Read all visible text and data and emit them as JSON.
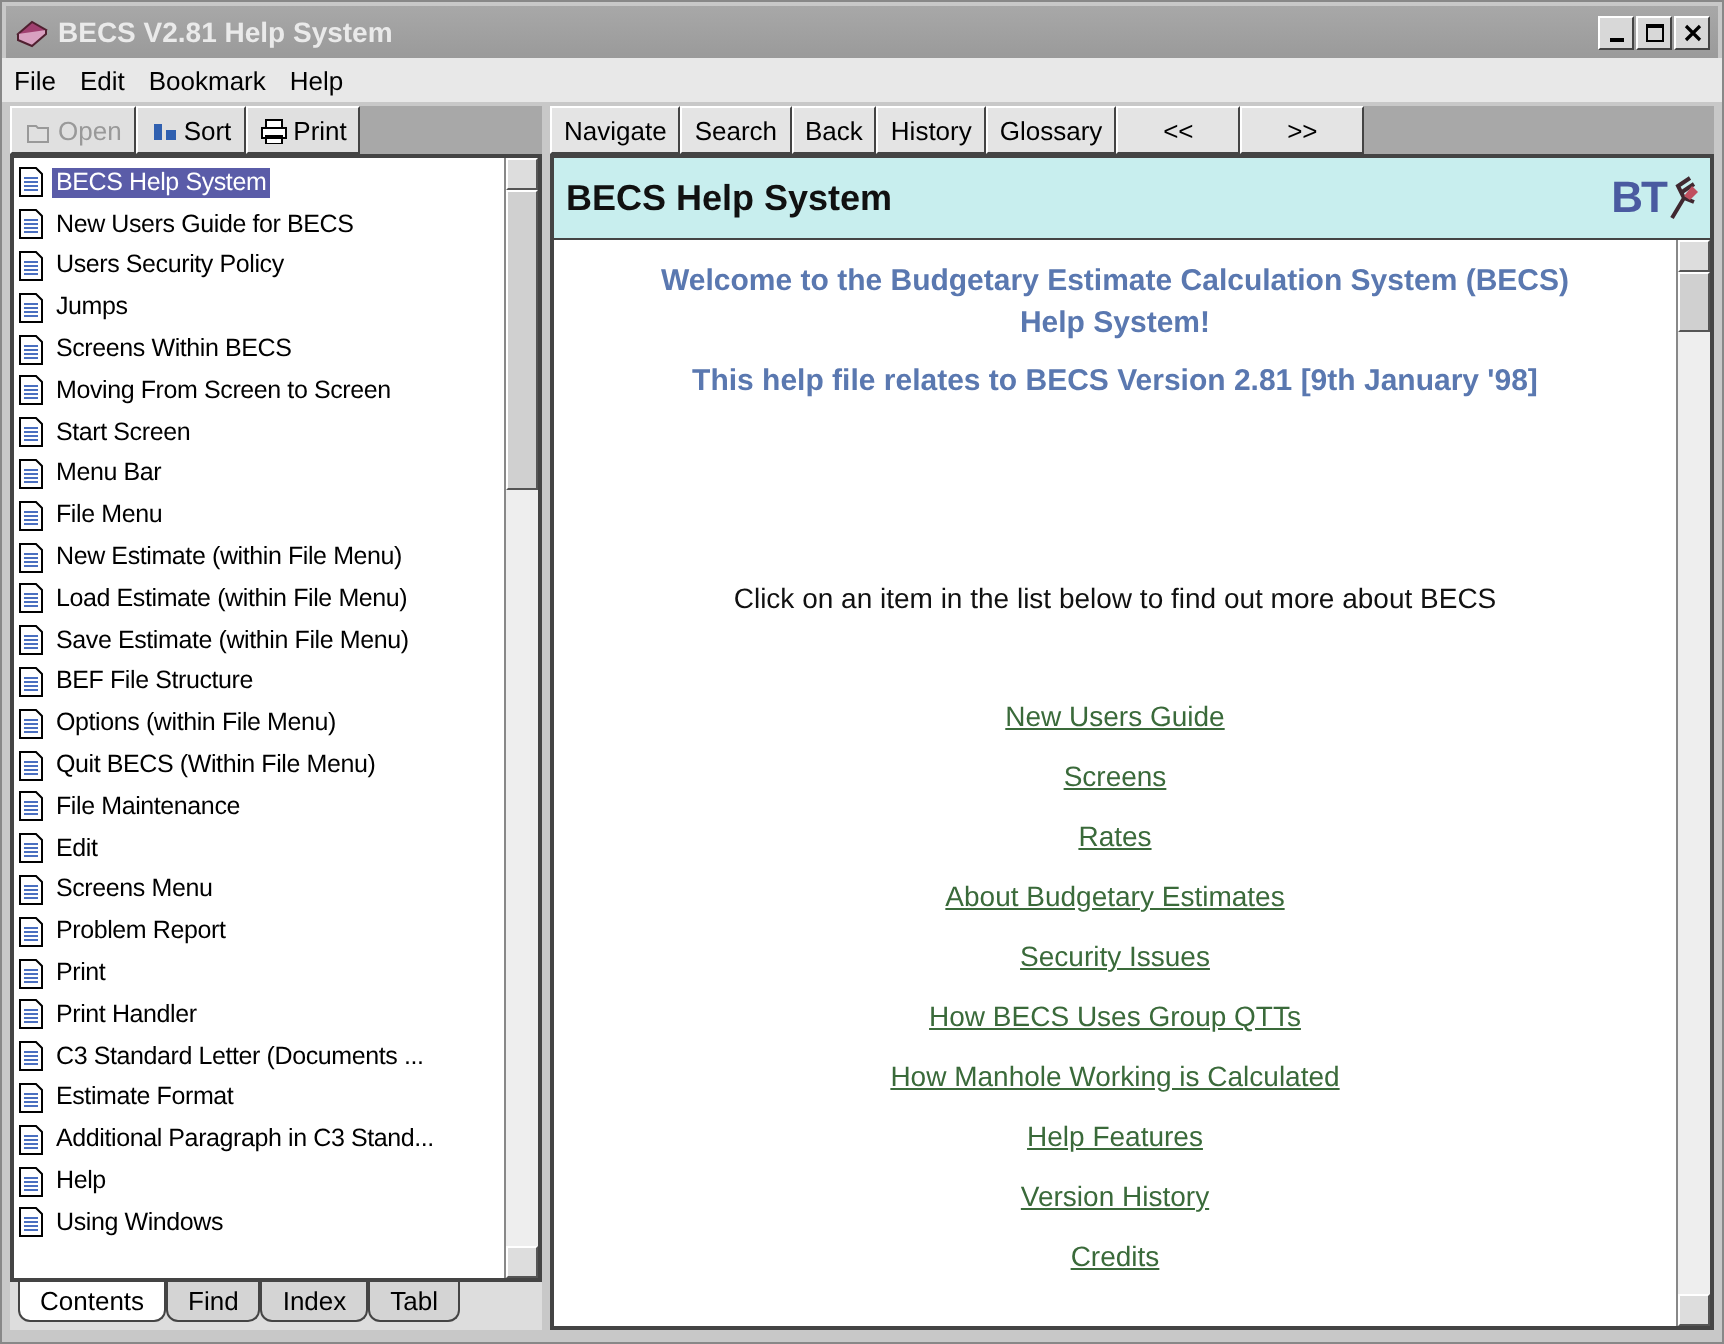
{
  "window": {
    "title": "BECS V2.81 Help System"
  },
  "menu": [
    "File",
    "Edit",
    "Bookmark",
    "Help"
  ],
  "toolbar": [
    {
      "label": "Open",
      "disabled": true,
      "kind": "open"
    },
    {
      "label": "Sort",
      "disabled": false,
      "kind": "sort"
    },
    {
      "label": "Print",
      "disabled": false,
      "kind": "print"
    }
  ],
  "topics": [
    {
      "label": "BECS Help System",
      "selected": true
    },
    {
      "label": "New Users Guide for BECS",
      "selected": false
    },
    {
      "label": "Users Security Policy",
      "selected": false
    },
    {
      "label": "Jumps",
      "selected": false
    },
    {
      "label": "Screens Within BECS",
      "selected": false
    },
    {
      "label": "Moving From Screen to Screen",
      "selected": false
    },
    {
      "label": "Start Screen",
      "selected": false
    },
    {
      "label": "Menu Bar",
      "selected": false
    },
    {
      "label": "File Menu",
      "selected": false
    },
    {
      "label": "New Estimate (within File Menu)",
      "selected": false
    },
    {
      "label": "Load Estimate (within File Menu)",
      "selected": false
    },
    {
      "label": "Save Estimate (within File Menu)",
      "selected": false
    },
    {
      "label": "BEF File Structure",
      "selected": false
    },
    {
      "label": "Options (within File Menu)",
      "selected": false
    },
    {
      "label": "Quit BECS (Within File Menu)",
      "selected": false
    },
    {
      "label": "File Maintenance",
      "selected": false
    },
    {
      "label": "Edit",
      "selected": false
    },
    {
      "label": "Screens Menu",
      "selected": false
    },
    {
      "label": "Problem Report",
      "selected": false
    },
    {
      "label": "Print",
      "selected": false
    },
    {
      "label": "Print Handler",
      "selected": false
    },
    {
      "label": "C3 Standard Letter (Documents ...",
      "selected": false
    },
    {
      "label": "Estimate Format",
      "selected": false
    },
    {
      "label": "Additional Paragraph in C3 Stand...",
      "selected": false
    },
    {
      "label": "Help",
      "selected": false
    },
    {
      "label": "Using Windows",
      "selected": false
    }
  ],
  "tabs": [
    {
      "label": "Contents",
      "selected": true
    },
    {
      "label": "Find",
      "selected": false
    },
    {
      "label": "Index",
      "selected": false
    },
    {
      "label": "Tabl",
      "selected": false
    }
  ],
  "nav_buttons": [
    "Navigate",
    "Search",
    "Back",
    "History",
    "Glossary",
    "<<",
    ">>"
  ],
  "page": {
    "heading": "BECS Help System",
    "logo": "BT",
    "welcome": "Welcome to the Budgetary Estimate Calculation System (BECS) Help System!",
    "version_note": "This help file relates to BECS Version 2.81 [9th January '98]",
    "instruction": "Click on an item in the list below to find out more about BECS",
    "links": [
      "New Users Guide",
      "Screens",
      "Rates",
      "About  Budgetary Estimates",
      "Security Issues",
      "How BECS Uses Group QTTs",
      "How Manhole Working is Calculated",
      "Help Features",
      "Version History",
      "Credits"
    ]
  }
}
